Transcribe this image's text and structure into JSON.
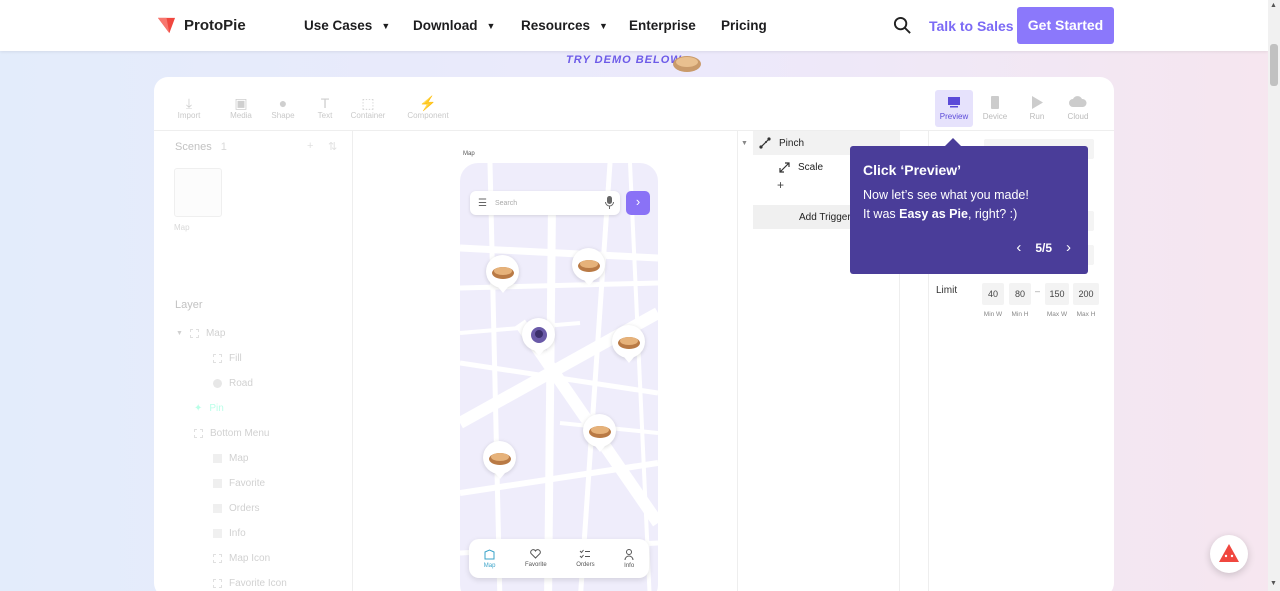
{
  "nav": {
    "brand": "ProtoPie",
    "items": [
      "Use Cases",
      "Download",
      "Resources",
      "Enterprise",
      "Pricing"
    ],
    "talk_to_sales": "Talk to Sales",
    "get_started": "Get Started"
  },
  "demo_label": "TRY DEMO BELOW",
  "toolbar": {
    "left": [
      "Import",
      "Media",
      "Shape",
      "Text",
      "Container",
      "Component"
    ],
    "right": [
      "Preview",
      "Device",
      "Run",
      "Cloud"
    ],
    "active": "Preview"
  },
  "scenes": {
    "title": "Scenes",
    "count": "1",
    "scene_name": "Map"
  },
  "layers": {
    "title": "Layer",
    "items": [
      "Map",
      "Fill",
      "Road",
      "Pin",
      "Bottom Menu",
      "Map",
      "Favorite",
      "Orders",
      "Info",
      "Map Icon",
      "Favorite Icon"
    ]
  },
  "canvas": {
    "scene_label": "Map",
    "search_placeholder": "Search",
    "bottom_menu": [
      "Map",
      "Favorite",
      "Orders",
      "Info"
    ]
  },
  "triggers": {
    "trigger": "Pinch",
    "response": "Scale",
    "add_trigger": "Add Trigger"
  },
  "limit": {
    "label": "Limit",
    "values": [
      "40",
      "80",
      "150",
      "200"
    ],
    "captions": [
      "Min W",
      "Min H",
      "Max W",
      "Max H"
    ],
    "dash": "–"
  },
  "tooltip": {
    "title": "Click ‘Preview’",
    "line1": "Now let’s see what you made!",
    "line2_prefix": "It was ",
    "line2_bold": "Easy as Pie",
    "line2_suffix": ", right? :)",
    "page": "5/5"
  },
  "colors": {
    "accent": "#8b78fb",
    "tooltip_bg": "#4a3d99",
    "brand_red": "#f0473f"
  }
}
